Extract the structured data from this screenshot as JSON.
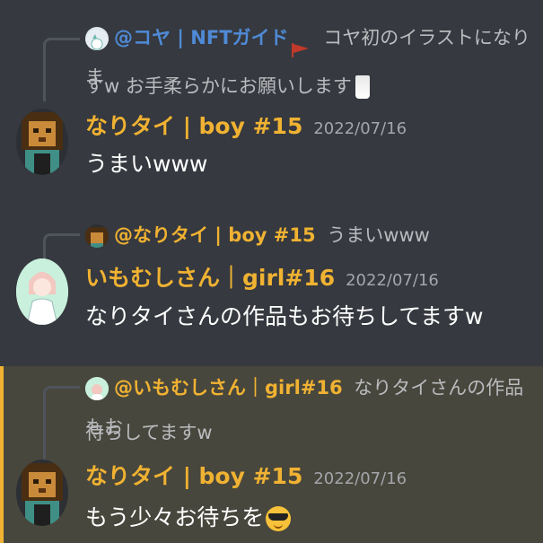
{
  "colors": {
    "accent": "#f0b232",
    "reply_link": "#4f8ad6",
    "background": "#36393f",
    "highlight": "#48473d"
  },
  "messages": [
    {
      "reply": {
        "icon": "koya-avatar-icon",
        "name": "@コヤ | NFTガイド",
        "text_line1": "コヤ初のイラストになりま",
        "text_line2": "すw お手柔らかにお願いします"
      },
      "author": "なりタイ | boy #15",
      "timestamp": "2022/07/16",
      "body": "うまいwww",
      "avatar_icon": "lion-pixel-avatar"
    },
    {
      "reply": {
        "icon": "lion-pixel-avatar-icon",
        "name": "@なりタイ | boy #15",
        "text_line1": "うまいwww"
      },
      "author": "いもむしさん｜girl#16",
      "timestamp": "2022/07/16",
      "body": "なりタイさんの作品もお待ちしてますw",
      "avatar_icon": "girl-drawing-avatar"
    },
    {
      "reply": {
        "icon": "girl-drawing-avatar-icon",
        "name": "@いもむしさん｜girl#16",
        "text_line1": "なりタイさんの作品もお",
        "text_line2": "待ちしてますw"
      },
      "author": "なりタイ | boy #15",
      "timestamp": "2022/07/16",
      "body": "もう少々お待ちを",
      "avatar_icon": "lion-pixel-avatar"
    }
  ]
}
